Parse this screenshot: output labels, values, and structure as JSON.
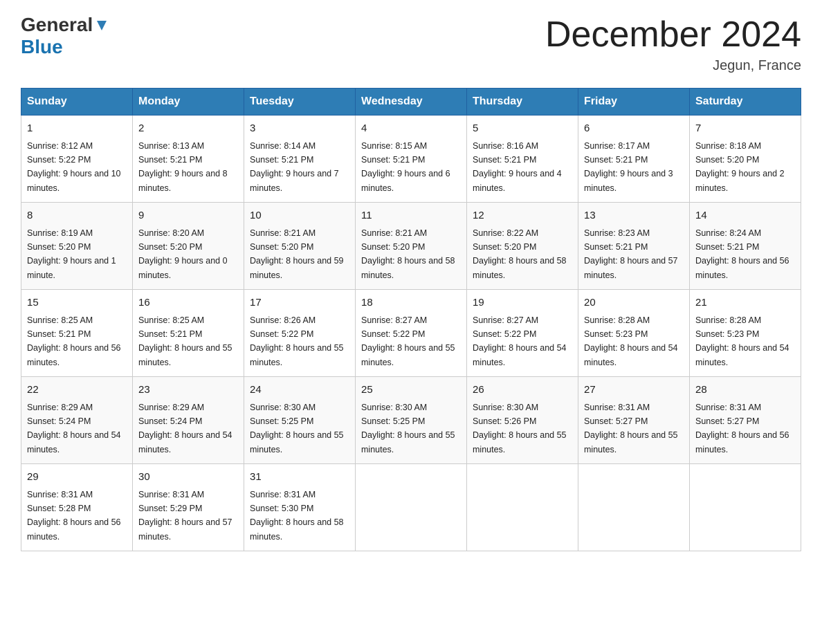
{
  "header": {
    "logo_line1": "General",
    "logo_line2": "Blue",
    "month_title": "December 2024",
    "location": "Jegun, France"
  },
  "weekdays": [
    "Sunday",
    "Monday",
    "Tuesday",
    "Wednesday",
    "Thursday",
    "Friday",
    "Saturday"
  ],
  "weeks": [
    [
      {
        "day": "1",
        "sunrise": "8:12 AM",
        "sunset": "5:22 PM",
        "daylight": "9 hours and 10 minutes."
      },
      {
        "day": "2",
        "sunrise": "8:13 AM",
        "sunset": "5:21 PM",
        "daylight": "9 hours and 8 minutes."
      },
      {
        "day": "3",
        "sunrise": "8:14 AM",
        "sunset": "5:21 PM",
        "daylight": "9 hours and 7 minutes."
      },
      {
        "day": "4",
        "sunrise": "8:15 AM",
        "sunset": "5:21 PM",
        "daylight": "9 hours and 6 minutes."
      },
      {
        "day": "5",
        "sunrise": "8:16 AM",
        "sunset": "5:21 PM",
        "daylight": "9 hours and 4 minutes."
      },
      {
        "day": "6",
        "sunrise": "8:17 AM",
        "sunset": "5:21 PM",
        "daylight": "9 hours and 3 minutes."
      },
      {
        "day": "7",
        "sunrise": "8:18 AM",
        "sunset": "5:20 PM",
        "daylight": "9 hours and 2 minutes."
      }
    ],
    [
      {
        "day": "8",
        "sunrise": "8:19 AM",
        "sunset": "5:20 PM",
        "daylight": "9 hours and 1 minute."
      },
      {
        "day": "9",
        "sunrise": "8:20 AM",
        "sunset": "5:20 PM",
        "daylight": "9 hours and 0 minutes."
      },
      {
        "day": "10",
        "sunrise": "8:21 AM",
        "sunset": "5:20 PM",
        "daylight": "8 hours and 59 minutes."
      },
      {
        "day": "11",
        "sunrise": "8:21 AM",
        "sunset": "5:20 PM",
        "daylight": "8 hours and 58 minutes."
      },
      {
        "day": "12",
        "sunrise": "8:22 AM",
        "sunset": "5:20 PM",
        "daylight": "8 hours and 58 minutes."
      },
      {
        "day": "13",
        "sunrise": "8:23 AM",
        "sunset": "5:21 PM",
        "daylight": "8 hours and 57 minutes."
      },
      {
        "day": "14",
        "sunrise": "8:24 AM",
        "sunset": "5:21 PM",
        "daylight": "8 hours and 56 minutes."
      }
    ],
    [
      {
        "day": "15",
        "sunrise": "8:25 AM",
        "sunset": "5:21 PM",
        "daylight": "8 hours and 56 minutes."
      },
      {
        "day": "16",
        "sunrise": "8:25 AM",
        "sunset": "5:21 PM",
        "daylight": "8 hours and 55 minutes."
      },
      {
        "day": "17",
        "sunrise": "8:26 AM",
        "sunset": "5:22 PM",
        "daylight": "8 hours and 55 minutes."
      },
      {
        "day": "18",
        "sunrise": "8:27 AM",
        "sunset": "5:22 PM",
        "daylight": "8 hours and 55 minutes."
      },
      {
        "day": "19",
        "sunrise": "8:27 AM",
        "sunset": "5:22 PM",
        "daylight": "8 hours and 54 minutes."
      },
      {
        "day": "20",
        "sunrise": "8:28 AM",
        "sunset": "5:23 PM",
        "daylight": "8 hours and 54 minutes."
      },
      {
        "day": "21",
        "sunrise": "8:28 AM",
        "sunset": "5:23 PM",
        "daylight": "8 hours and 54 minutes."
      }
    ],
    [
      {
        "day": "22",
        "sunrise": "8:29 AM",
        "sunset": "5:24 PM",
        "daylight": "8 hours and 54 minutes."
      },
      {
        "day": "23",
        "sunrise": "8:29 AM",
        "sunset": "5:24 PM",
        "daylight": "8 hours and 54 minutes."
      },
      {
        "day": "24",
        "sunrise": "8:30 AM",
        "sunset": "5:25 PM",
        "daylight": "8 hours and 55 minutes."
      },
      {
        "day": "25",
        "sunrise": "8:30 AM",
        "sunset": "5:25 PM",
        "daylight": "8 hours and 55 minutes."
      },
      {
        "day": "26",
        "sunrise": "8:30 AM",
        "sunset": "5:26 PM",
        "daylight": "8 hours and 55 minutes."
      },
      {
        "day": "27",
        "sunrise": "8:31 AM",
        "sunset": "5:27 PM",
        "daylight": "8 hours and 55 minutes."
      },
      {
        "day": "28",
        "sunrise": "8:31 AM",
        "sunset": "5:27 PM",
        "daylight": "8 hours and 56 minutes."
      }
    ],
    [
      {
        "day": "29",
        "sunrise": "8:31 AM",
        "sunset": "5:28 PM",
        "daylight": "8 hours and 56 minutes."
      },
      {
        "day": "30",
        "sunrise": "8:31 AM",
        "sunset": "5:29 PM",
        "daylight": "8 hours and 57 minutes."
      },
      {
        "day": "31",
        "sunrise": "8:31 AM",
        "sunset": "5:30 PM",
        "daylight": "8 hours and 58 minutes."
      },
      null,
      null,
      null,
      null
    ]
  ]
}
